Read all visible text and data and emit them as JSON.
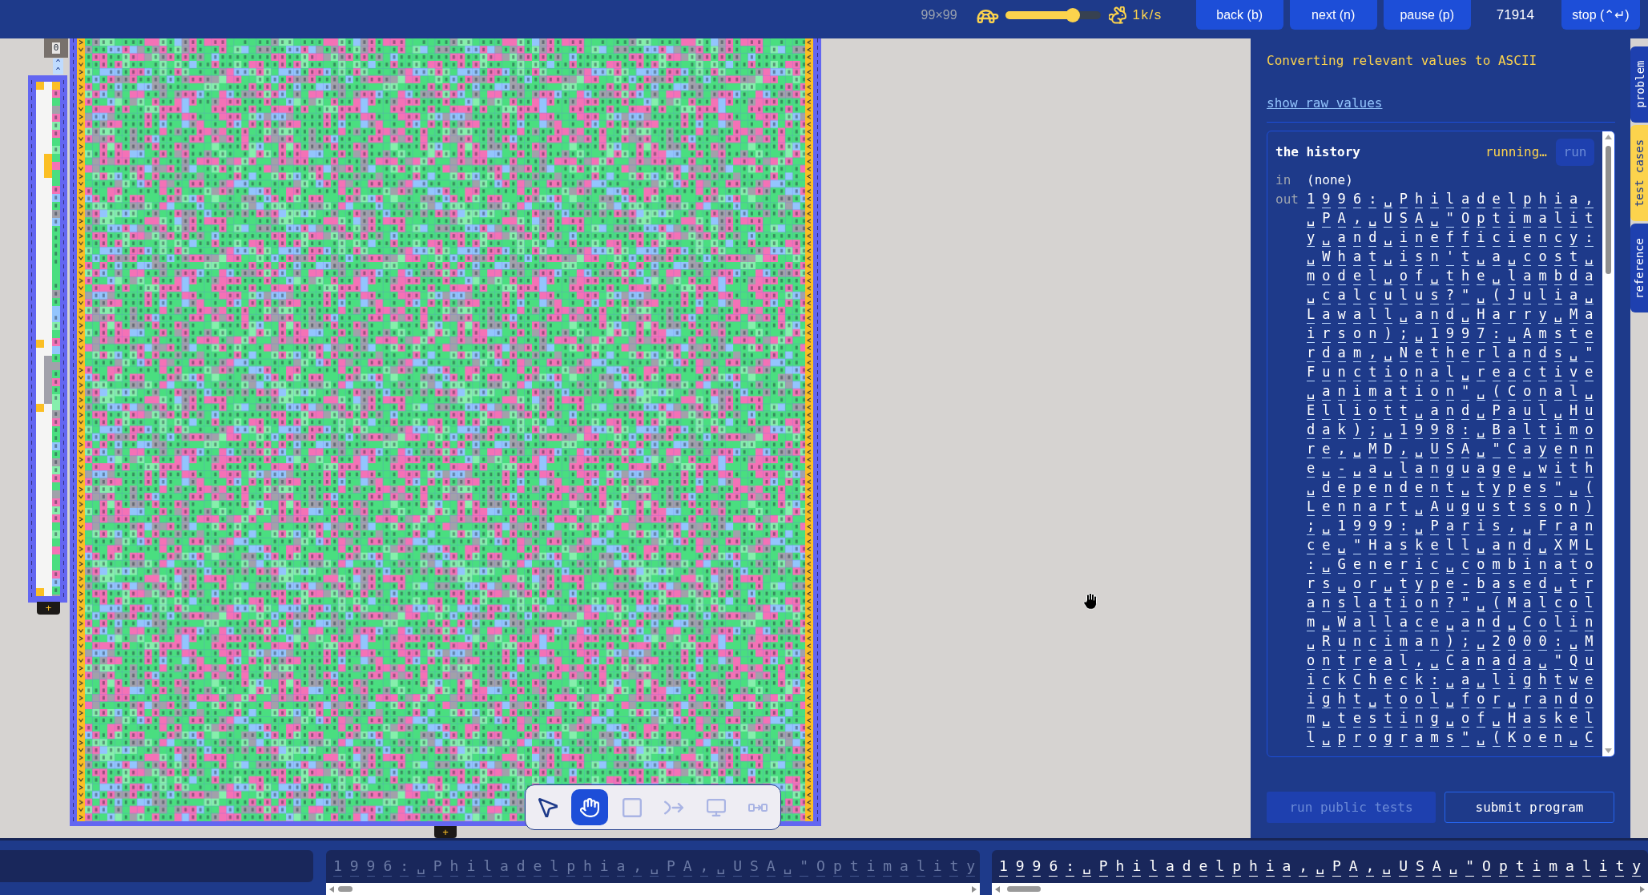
{
  "top_bar": {
    "grid_size": "99×99",
    "speed": {
      "level": 0.75
    },
    "speed_label": "1k/s",
    "buttons": [
      {
        "label": "back (b)"
      },
      {
        "label": "next (n)"
      },
      {
        "label": "pause (p)"
      }
    ],
    "step_count": "71914",
    "stop_button": {
      "label": "stop (⌃↵)"
    }
  },
  "canvas": {
    "side_grid": {
      "header": "0",
      "pointers": [
        "^",
        "^"
      ],
      "add_button": "+"
    },
    "main_grid": {
      "add_button": "+"
    },
    "tools": [
      {
        "kind": "pointer",
        "selected": false,
        "disabled": false
      },
      {
        "kind": "hand",
        "selected": true,
        "disabled": false
      },
      {
        "kind": "rectangle",
        "selected": false,
        "disabled": true
      },
      {
        "kind": "connector",
        "selected": false,
        "disabled": true
      },
      {
        "kind": "display",
        "selected": false,
        "disabled": true
      },
      {
        "kind": "link",
        "selected": false,
        "disabled": true
      }
    ]
  },
  "panel": {
    "status": "Converting relevant values to ASCII",
    "raw_values_link": "show raw values",
    "test_case": {
      "title": "the history",
      "status": "running…",
      "run_button": {
        "label": "run",
        "disabled": true
      },
      "input_label": "in",
      "input": "(none)",
      "output_label": "out",
      "output_cells": [
        "1",
        "9",
        "9",
        "6",
        ":",
        "␣",
        "P",
        "h",
        "i",
        "l",
        "a",
        "d",
        "e",
        "l",
        "p",
        "h",
        "i",
        "a",
        ",",
        "␣",
        "P",
        "A",
        ",",
        "␣",
        "U",
        "S",
        "A",
        "␣",
        "\"",
        "O",
        "p",
        "t",
        "i",
        "m",
        "a",
        "l",
        "i",
        "t",
        "y",
        "␣",
        "a",
        "n",
        "d",
        "␣",
        "i",
        "n",
        "e",
        "f",
        "f",
        "i",
        "c",
        "i",
        "e",
        "n",
        "c",
        "y",
        ":",
        "␣",
        "W",
        "h",
        "a",
        "t",
        "␣",
        "i",
        "s",
        "n",
        "'",
        "t",
        "␣",
        "a",
        "␣",
        "c",
        "o",
        "s",
        "t",
        "␣",
        "m",
        "o",
        "d",
        "e",
        "l",
        "␣",
        "o",
        "f",
        "␣",
        "t",
        "h",
        "e",
        "␣",
        "l",
        "a",
        "m",
        "b",
        "d",
        "a",
        "␣",
        "c",
        "a",
        "l",
        "c",
        "u",
        "l",
        "u",
        "s",
        "?",
        "\"",
        "␣",
        "(",
        "J",
        "u",
        "l",
        "i",
        "a",
        "␣",
        "L",
        "a",
        "w",
        "a",
        "l",
        "l",
        "␣",
        "a",
        "n",
        "d",
        "␣",
        "H",
        "a",
        "r",
        "r",
        "y",
        "␣",
        "M",
        "a",
        "i",
        "r",
        "s",
        "o",
        "n",
        ")",
        ";",
        "␣",
        "1",
        "9",
        "9",
        "7",
        ":",
        "␣",
        "A",
        "m",
        "s",
        "t",
        "e",
        "r",
        "d",
        "a",
        "m",
        ",",
        "␣",
        "N",
        "e",
        "t",
        "h",
        "e",
        "r",
        "l",
        "a",
        "n",
        "d",
        "s",
        "␣",
        "\"",
        "F",
        "u",
        "n",
        "c",
        "t",
        "i",
        "o",
        "n",
        "a",
        "l",
        "␣",
        "r",
        "e",
        "a",
        "c",
        "t",
        "i",
        "v",
        "e",
        "␣",
        "a",
        "n",
        "i",
        "m",
        "a",
        "t",
        "i",
        "o",
        "n",
        "\"",
        "␣",
        "(",
        "C",
        "o",
        "n",
        "a",
        "l",
        "␣",
        "E",
        "l",
        "l",
        "i",
        "o",
        "t",
        "t",
        "␣",
        "a",
        "n",
        "d",
        "␣",
        "P",
        "a",
        "u",
        "l",
        "␣",
        "H",
        "u",
        "d",
        "a",
        "k",
        ")",
        ";",
        "␣",
        "1",
        "9",
        "9",
        "8",
        ":",
        "␣",
        "B",
        "a",
        "l",
        "t",
        "i",
        "m",
        "o",
        "r",
        "e",
        ",",
        "␣",
        "M",
        "D",
        ",",
        "␣",
        "U",
        "S",
        "A",
        "␣",
        "\"",
        "C",
        "a",
        "y",
        "e",
        "n",
        "n",
        "e",
        "␣",
        "-",
        "␣",
        "a",
        "␣",
        "l",
        "a",
        "n",
        "g",
        "u",
        "a",
        "g",
        "e",
        "␣",
        "w",
        "i",
        "t",
        "h",
        "␣",
        "d",
        "e",
        "p",
        "e",
        "n",
        "d",
        "e",
        "n",
        "t",
        "␣",
        "t",
        "y",
        "p",
        "e",
        "s",
        "\"",
        "␣",
        "(",
        "L",
        "e",
        "n",
        "n",
        "a",
        "r",
        "t",
        "␣",
        "A",
        "u",
        "g",
        "u",
        "s",
        "t",
        "s",
        "s",
        "o",
        "n",
        ")",
        ";",
        "␣",
        "1",
        "9",
        "9",
        "9",
        ":",
        "␣",
        "P",
        "a",
        "r",
        "i",
        "s",
        ",",
        "␣",
        "F",
        "r",
        "a",
        "n",
        "c",
        "e",
        "␣",
        "\"",
        "H",
        "a",
        "s",
        "k",
        "e",
        "l",
        "l",
        "␣",
        "a",
        "n",
        "d",
        "␣",
        "X",
        "M",
        "L",
        ":",
        "␣",
        "G",
        "e",
        "n",
        "e",
        "r",
        "i",
        "c",
        "␣",
        "c",
        "o",
        "m",
        "b",
        "i",
        "n",
        "a",
        "t",
        "o",
        "r",
        "s",
        "␣",
        "o",
        "r",
        "␣",
        "t",
        "y",
        "p",
        "e",
        "-",
        "b",
        "a",
        "s",
        "e",
        "d",
        "␣",
        "t",
        "r",
        "a",
        "n",
        "s",
        "l",
        "a",
        "t",
        "i",
        "o",
        "n",
        "?",
        "\"",
        "␣",
        "(",
        "M",
        "a",
        "l",
        "c",
        "o",
        "l",
        "m",
        "␣",
        "W",
        "a",
        "l",
        "l",
        "a",
        "c",
        "e",
        "␣",
        "a",
        "n",
        "d",
        "␣",
        "C",
        "o",
        "l",
        "i",
        "n",
        "␣",
        "R",
        "u",
        "n",
        "c",
        "i",
        "m",
        "a",
        "n",
        ")",
        ";",
        "␣",
        "2",
        "0",
        "0",
        "0",
        ":",
        "␣",
        "M",
        "o",
        "n",
        "t",
        "r",
        "e",
        "a",
        "l",
        ",",
        "␣",
        "C",
        "a",
        "n",
        "a",
        "d",
        "a",
        "␣",
        "\"",
        "Q",
        "u",
        "i",
        "c",
        "k",
        "C",
        "h",
        "e",
        "c",
        "k",
        ":",
        "␣",
        "a",
        "␣",
        "l",
        "i",
        "g",
        "h",
        "t",
        "w",
        "e",
        "i",
        "g",
        "h",
        "t",
        "␣",
        "t",
        "o",
        "o",
        "l",
        "␣",
        "f",
        "o",
        "r",
        "␣",
        "r",
        "a",
        "n",
        "d",
        "o",
        "m",
        "␣",
        "t",
        "e",
        "s",
        "t",
        "i",
        "n",
        "g",
        "␣",
        "o",
        "f",
        "␣",
        "H",
        "a",
        "s",
        "k",
        "e",
        "l",
        "l",
        "␣",
        "p",
        "r",
        "o",
        "g",
        "r",
        "a",
        "m",
        "s",
        "\"",
        "␣",
        "(",
        "K",
        "o",
        "e",
        "n",
        "␣",
        "C"
      ]
    },
    "run_tests_button": {
      "label": "run public tests",
      "disabled": true
    },
    "submit_button": {
      "label": "submit program"
    }
  },
  "side_tabs": [
    {
      "label": "problem",
      "selected": false
    },
    {
      "label": "test cases",
      "selected": true
    },
    {
      "label": "reference",
      "selected": false
    }
  ],
  "bottom_panes": [
    {
      "cells": [
        "1",
        "9",
        "9",
        "6",
        ":",
        "␣",
        "P",
        "h",
        "i",
        "l",
        "a",
        "d",
        "e",
        "l",
        "p",
        "h",
        "i",
        "a",
        ",",
        "␣",
        "P",
        "A",
        ",",
        "␣",
        "U",
        "S",
        "A",
        "␣",
        "\"",
        "O",
        "p",
        "t",
        "i",
        "m",
        "a",
        "l",
        "i",
        "t",
        "y"
      ],
      "muted": true
    },
    {
      "cells": [
        "1",
        "9",
        "9",
        "6",
        ":",
        "␣",
        "P",
        "h",
        "i",
        "l",
        "a",
        "d",
        "e",
        "l",
        "p",
        "h",
        "i",
        "a",
        ",",
        "␣",
        "P",
        "A",
        ",",
        "␣",
        "U",
        "S",
        "A",
        "␣",
        "\"",
        "O",
        "p",
        "t",
        "i",
        "m",
        "a",
        "l",
        "i",
        "t",
        "y"
      ],
      "muted": false
    }
  ]
}
